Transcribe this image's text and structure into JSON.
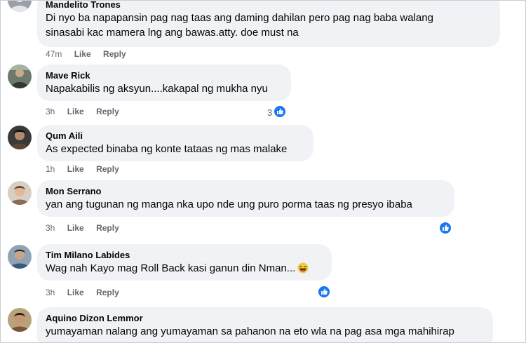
{
  "comments": [
    {
      "author": "Mandelito Trones",
      "text": "Di nyo ba napapansin pag nag taas ang daming dahilan pero pag nag baba walang",
      "text2": "sinasabi kac mamera lng ang bawas.atty. doe must na",
      "time": "47m",
      "like": "Like",
      "reply": "Reply"
    },
    {
      "author": "Mave Rick",
      "text": "Napakabilis ng aksyun....kakapal ng mukha nyu",
      "time": "3h",
      "like": "Like",
      "reply": "Reply",
      "reaction_count": "3"
    },
    {
      "author": "Qum Aili",
      "text": "As expected binaba ng konte tataas ng mas malake",
      "time": "1h",
      "like": "Like",
      "reply": "Reply"
    },
    {
      "author": "Mon Serrano",
      "text": "yan ang tugunan ng manga nka upo nde ung puro porma taas ng presyo ibaba",
      "time": "3h",
      "like": "Like",
      "reply": "Reply"
    },
    {
      "author": "Tim Milano Labides",
      "text": "Wag nah Kayo mag Roll Back kasi ganun din Nman...",
      "time": "3h",
      "like": "Like",
      "reply": "Reply"
    },
    {
      "author": "Aquino Dizon Lemmor",
      "text": "yumayaman nalang ang yumayaman sa pahanon na eto wla na pag asa mga mahihirap"
    }
  ],
  "colors": {
    "bubble": "#f0f2f5",
    "text": "#050505",
    "meta": "#65676b",
    "like_blue": "#1877f2"
  },
  "icons": {
    "reaction": "like-thumb-icon",
    "emoji": "laughing-emoji-icon"
  }
}
